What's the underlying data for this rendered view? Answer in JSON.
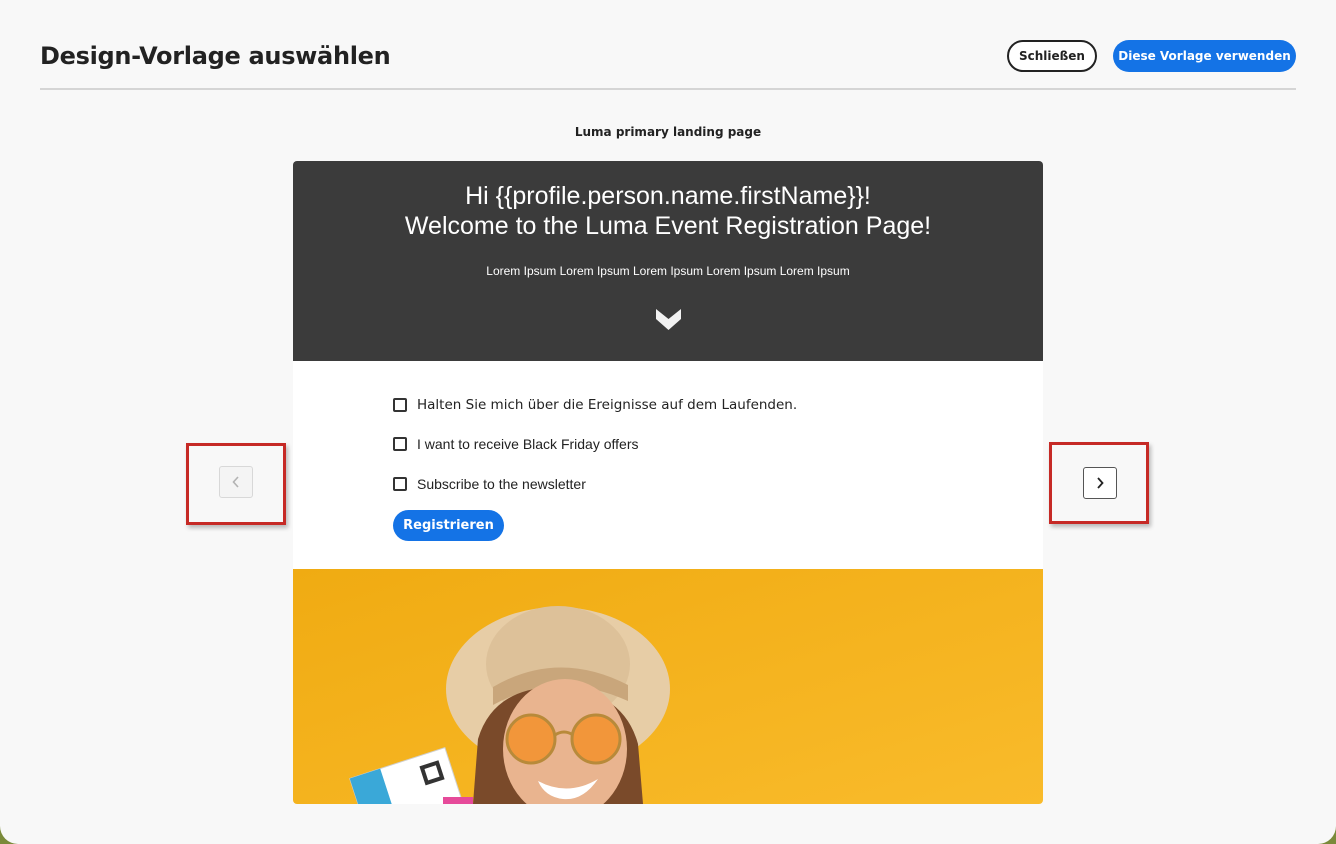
{
  "dialog": {
    "title": "Design-Vorlage auswählen",
    "close_label": "Schließen",
    "use_label": "Diese Vorlage verwenden"
  },
  "template": {
    "name": "Luma primary landing page"
  },
  "preview": {
    "hero_line1": "Hi {{profile.person.name.firstName}}!",
    "hero_line2": "Welcome to the Luma Event Registration Page!",
    "hero_sub": "Lorem Ipsum Lorem Ipsum Lorem Ipsum Lorem Ipsum Lorem Ipsum",
    "checkboxes": [
      {
        "label": "Halten Sie mich über die Ereignisse auf dem Laufenden.",
        "checked": false
      },
      {
        "label": "I want to receive Black Friday offers",
        "checked": false
      },
      {
        "label": "Subscribe to the newsletter",
        "checked": false
      }
    ],
    "register_label": "Registrieren"
  },
  "icons": {
    "scroll_down": "chevron-down-icon",
    "previous": "chevron-left-icon",
    "next": "chevron-right-icon"
  },
  "colors": {
    "accent": "#1473e6",
    "hero_bg": "#3b3b3b",
    "photo_bg": "#f2b21c",
    "highlight_border": "#c62a26"
  }
}
